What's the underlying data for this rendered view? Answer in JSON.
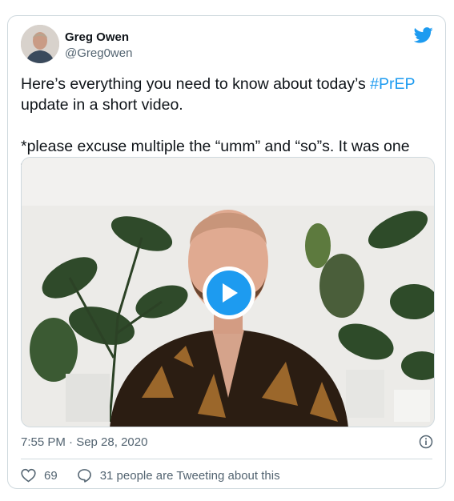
{
  "tweet": {
    "author_name": "Greg Owen",
    "author_handle": "@Greg0wen",
    "text_line1_prefix": "Here’s everything you need to know about today’s ",
    "hashtag": "#PrEP",
    "text_line1_suffix": " update in a short video.",
    "text_line2": "*please excuse multiple the “umm” and “so”s. It was one take.",
    "timestamp": "7:55 PM · Sep 28, 2020",
    "like_count": "69",
    "conversation_label": "31 people are Tweeting about this"
  },
  "icons": {
    "brand": "twitter-bird-icon",
    "play": "play-icon",
    "info": "info-icon",
    "like": "heart-icon",
    "reply": "speech-bubble-icon"
  },
  "colors": {
    "brand_blue": "#1d9bf0",
    "text_primary": "#0f1419",
    "text_secondary": "#536471",
    "border": "#cfd9de"
  }
}
